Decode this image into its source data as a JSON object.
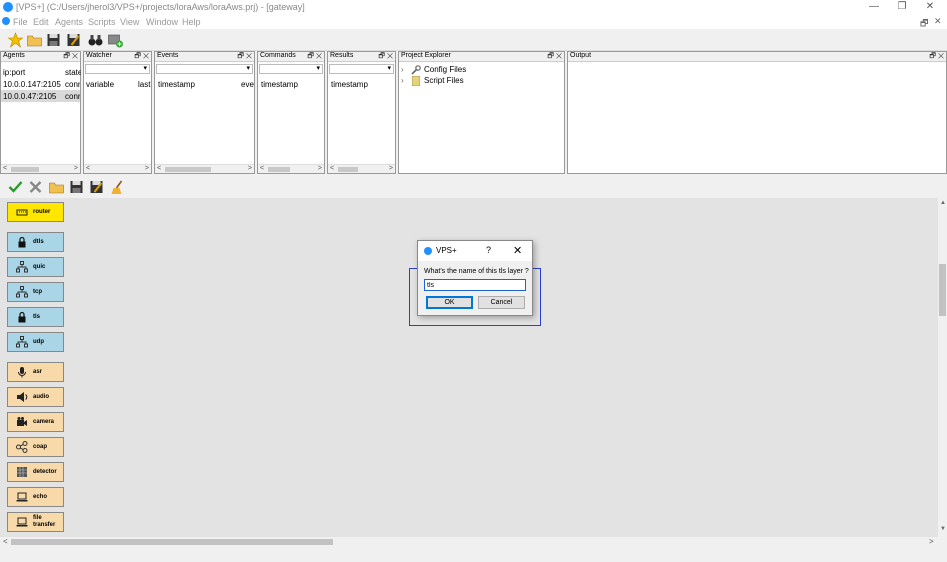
{
  "window": {
    "title": "[VPS+] (C:/Users/jherol3/VPS+/projects/loraAws/loraAws.prj) - [gateway]",
    "minimize": "—",
    "restore": "❐",
    "close": "✕"
  },
  "menu": {
    "items": [
      "File",
      "Edit",
      "Agents",
      "Scripts",
      "View",
      "Window",
      "Help"
    ],
    "restore": "🗗",
    "close": "✕"
  },
  "panels": {
    "agents": {
      "title": "Agents",
      "headers": [
        "ip:port",
        "state"
      ],
      "rows": [
        [
          "10.0.0.147:2105",
          "conn"
        ],
        [
          "10.0.0.47:2105",
          "conn"
        ]
      ]
    },
    "watcher": {
      "title": "Watcher",
      "headers": [
        "variable",
        "last"
      ]
    },
    "events": {
      "title": "Events",
      "headers": [
        "timestamp",
        "eve"
      ]
    },
    "commands": {
      "title": "Commands",
      "headers": [
        "timestamp"
      ]
    },
    "results": {
      "title": "Results",
      "headers": [
        "timestamp"
      ]
    },
    "project_explorer": {
      "title": "Project Explorer",
      "items": [
        "Config Files",
        "Script Files"
      ]
    },
    "output": {
      "title": "Output"
    }
  },
  "panel_controls": {
    "float": "🗗",
    "close": "✕"
  },
  "scroll": {
    "left": "<",
    "right": ">"
  },
  "palette": [
    {
      "label": "router",
      "color": "yellow",
      "icon": "router-icon"
    },
    {
      "label": "dtls",
      "color": "blue",
      "icon": "lock-icon"
    },
    {
      "label": "quic",
      "color": "blue",
      "icon": "network-icon"
    },
    {
      "label": "tcp",
      "color": "blue",
      "icon": "network-icon"
    },
    {
      "label": "tls",
      "color": "blue",
      "icon": "lock-icon"
    },
    {
      "label": "udp",
      "color": "blue",
      "icon": "network-icon"
    },
    {
      "label": "asr",
      "color": "peach",
      "icon": "microphone-icon"
    },
    {
      "label": "audio",
      "color": "peach",
      "icon": "speaker-icon"
    },
    {
      "label": "camera",
      "color": "peach",
      "icon": "camera-icon"
    },
    {
      "label": "coap",
      "color": "peach",
      "icon": "nodes-icon"
    },
    {
      "label": "detector",
      "color": "peach",
      "icon": "grid-icon"
    },
    {
      "label": "echo",
      "color": "peach",
      "icon": "laptop-icon"
    },
    {
      "label": "file transfer",
      "color": "peach",
      "icon": "laptop-icon"
    }
  ],
  "dialog": {
    "title": "VPS+",
    "help": "?",
    "close": "✕",
    "prompt": "What's the name of this tls layer ?",
    "input_value": "tls",
    "ok": "OK",
    "cancel": "Cancel"
  }
}
